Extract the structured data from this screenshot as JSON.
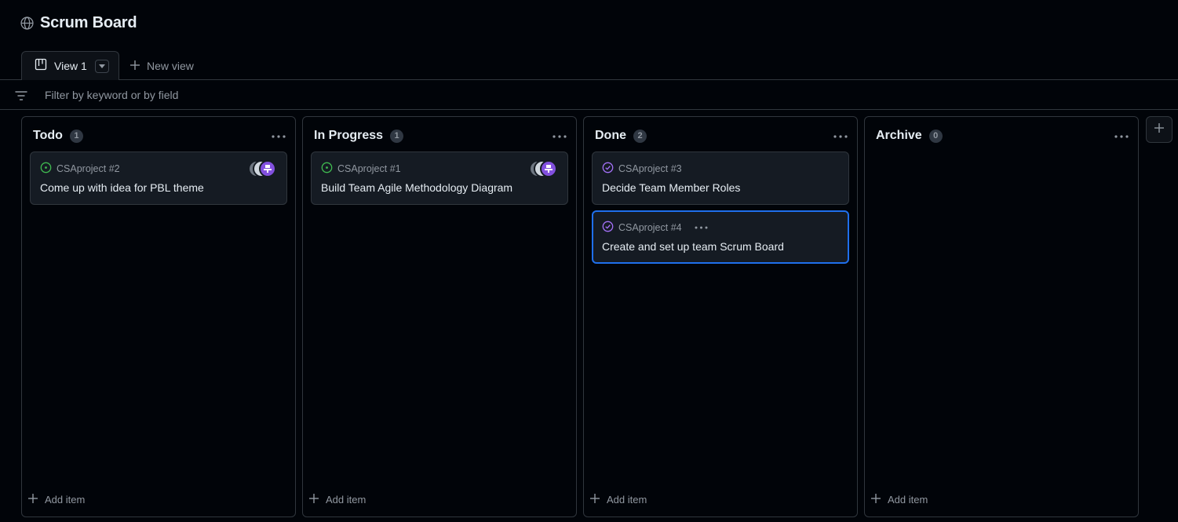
{
  "page": {
    "title": "Scrum Board",
    "title_icon": "globe-icon"
  },
  "tabs": {
    "active": {
      "label": "View 1",
      "icon": "board-icon"
    },
    "new_view_label": "New view"
  },
  "filter": {
    "placeholder": "Filter by keyword or by field"
  },
  "columns": [
    {
      "name": "Todo",
      "count": "1",
      "cards": [
        {
          "ref": "CSAproject #2",
          "title": "Come up with idea for PBL theme",
          "status": "open",
          "has_avatars": true
        }
      ],
      "add_label": "Add item"
    },
    {
      "name": "In Progress",
      "count": "1",
      "cards": [
        {
          "ref": "CSAproject #1",
          "title": "Build Team Agile Methodology Diagram",
          "status": "open",
          "has_avatars": true
        }
      ],
      "add_label": "Add item"
    },
    {
      "name": "Done",
      "count": "2",
      "cards": [
        {
          "ref": "CSAproject #3",
          "title": "Decide Team Member Roles",
          "status": "closed",
          "has_avatars": false
        },
        {
          "ref": "CSAproject #4",
          "title": "Create and set up team Scrum Board",
          "status": "closed",
          "has_avatars": false,
          "selected": true
        }
      ],
      "add_label": "Add item"
    },
    {
      "name": "Archive",
      "count": "0",
      "cards": [],
      "add_label": "Add item"
    }
  ],
  "colors": {
    "background": "#010409",
    "open_status": "#3fb950",
    "closed_status": "#a371f7",
    "selected_border": "#1f6feb"
  }
}
